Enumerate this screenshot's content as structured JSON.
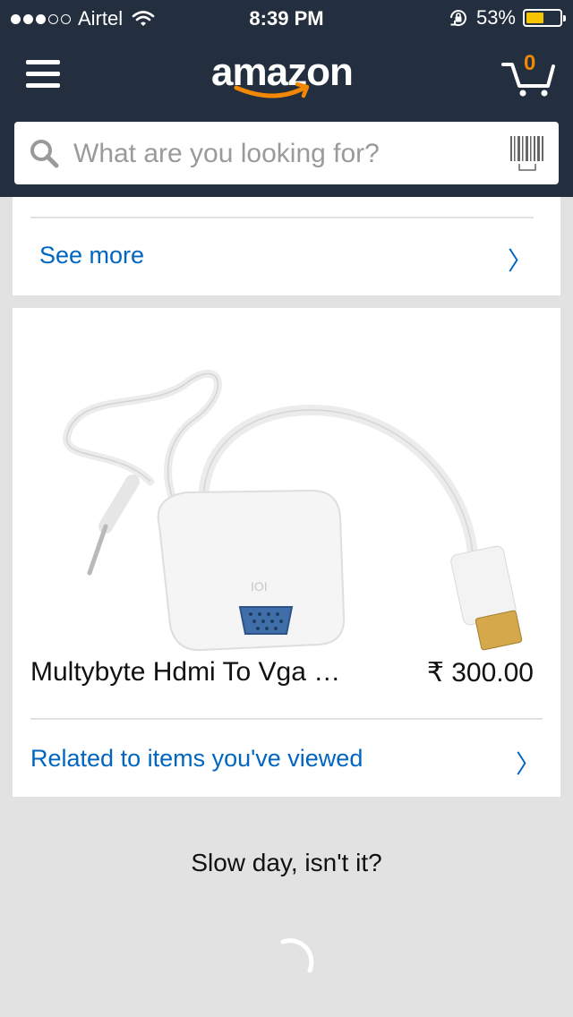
{
  "status_bar": {
    "carrier": "Airtel",
    "time": "8:39 PM",
    "battery": "53%",
    "battery_level": 0.53
  },
  "header": {
    "logo": "amazon",
    "cart_count": "0",
    "brand_color": "#232f3e",
    "accent_color": "#f08804"
  },
  "search": {
    "placeholder": "What are you looking for?"
  },
  "card_top": {
    "see_more": "See more"
  },
  "product_card": {
    "title": "Multybyte Hdmi To Vga …",
    "price": "₹ 300.00",
    "related_link": "Related to items you've viewed"
  },
  "footer": {
    "message": "Slow day, isn't it?"
  },
  "icons": [
    "signal-dots-icon",
    "wifi-icon",
    "rotation-lock-icon",
    "battery-icon",
    "menu-icon",
    "cart-icon",
    "search-icon",
    "barcode-icon",
    "chevron-right-icon",
    "loading-spinner-icon"
  ]
}
